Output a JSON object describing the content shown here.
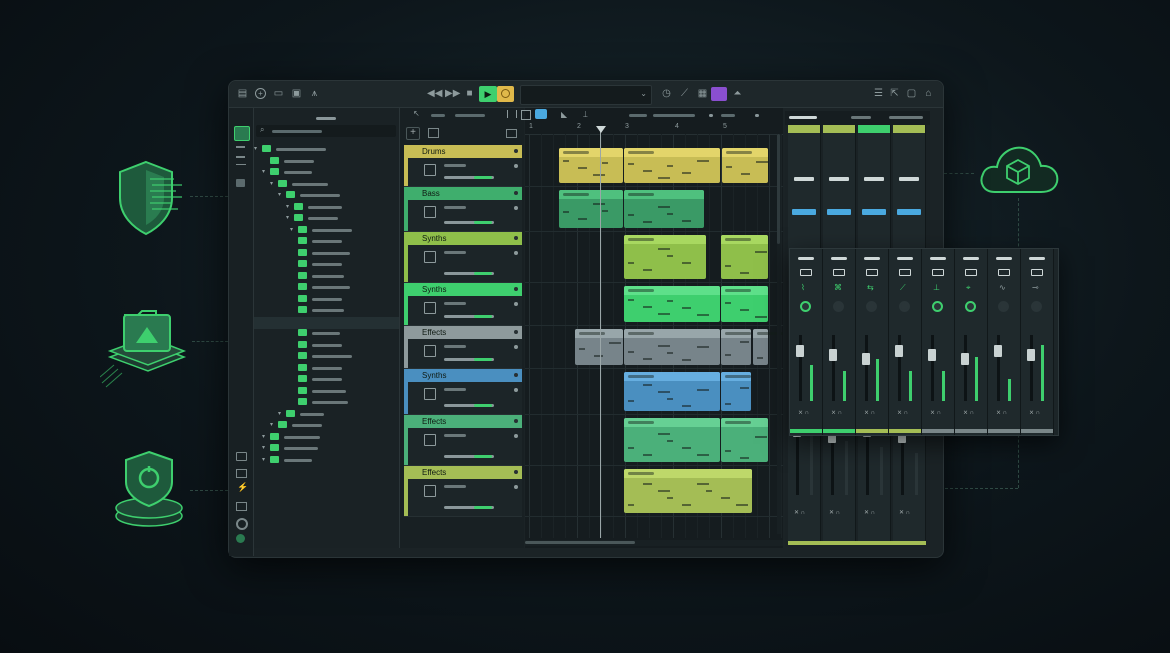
{
  "tracks": [
    {
      "name": "Drums",
      "color": "#c8bd55"
    },
    {
      "name": "Bass",
      "color": "#3fae6d"
    },
    {
      "name": "Synths",
      "color": "#8fbf4a"
    },
    {
      "name": "Synths",
      "color": "#3ecf6e"
    },
    {
      "name": "Effects",
      "color": "#8e9a9c"
    },
    {
      "name": "Synths",
      "color": "#4a8fc0"
    },
    {
      "name": "Effects",
      "color": "#4bb07a"
    },
    {
      "name": "Effects",
      "color": "#a4bd55"
    }
  ],
  "ruler": {
    "marks": [
      "1",
      "2",
      "3",
      "4",
      "5"
    ]
  },
  "transport": {
    "play_color": "#3ecf6e",
    "record_color": "#e0b94a"
  },
  "colors": {
    "accent": "#3ecf6e",
    "purple": "#8a4fcf",
    "blue": "#4aa9e0"
  },
  "icons": [
    "shield-icon",
    "folder-stack-icon",
    "sync-location-icon",
    "cloud-box-icon"
  ]
}
